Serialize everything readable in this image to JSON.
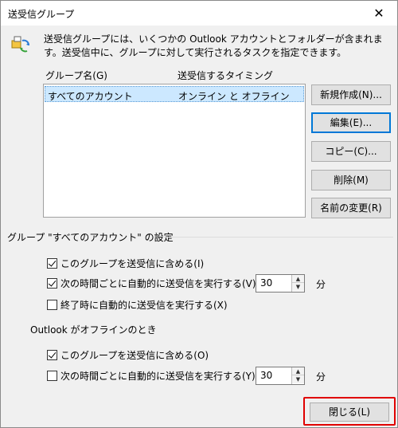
{
  "window": {
    "title": "送受信グループ",
    "close_glyph": "✕"
  },
  "description": "送受信グループには、いくつかの Outlook アカウントとフォルダーが含まれます。送受信中に、グループに対して実行されるタスクを指定できます。",
  "list": {
    "col_name": "グループ名(G)",
    "col_timing": "送受信するタイミング",
    "rows": [
      {
        "name": "すべてのアカウント",
        "timing": "オンライン と オフライン"
      }
    ]
  },
  "buttons": {
    "new": "新規作成(N)...",
    "edit": "編集(E)...",
    "copy": "コピー(C)...",
    "delete": "削除(M)",
    "rename": "名前の変更(R)",
    "close": "閉じる(L)"
  },
  "settings": {
    "title": "グループ \"すべてのアカウント\" の設定",
    "online": {
      "include": {
        "label": "このグループを送受信に含める(I)",
        "checked": true
      },
      "auto": {
        "label": "次の時間ごとに自動的に送受信を実行する(V)",
        "checked": true,
        "value": "30",
        "unit": "分"
      },
      "on_exit": {
        "label": "終了時に自動的に送受信を実行する(X)",
        "checked": false
      }
    },
    "offline_title": "Outlook がオフラインのとき",
    "offline": {
      "include": {
        "label": "このグループを送受信に含める(O)",
        "checked": true
      },
      "auto": {
        "label": "次の時間ごとに自動的に送受信を実行する(Y)",
        "checked": false,
        "value": "30",
        "unit": "分"
      }
    }
  },
  "icons": {
    "info": "send-receive-icon"
  },
  "colors": {
    "selection": "#cce8ff",
    "focus": "#0078d7",
    "highlight": "#e00000"
  }
}
